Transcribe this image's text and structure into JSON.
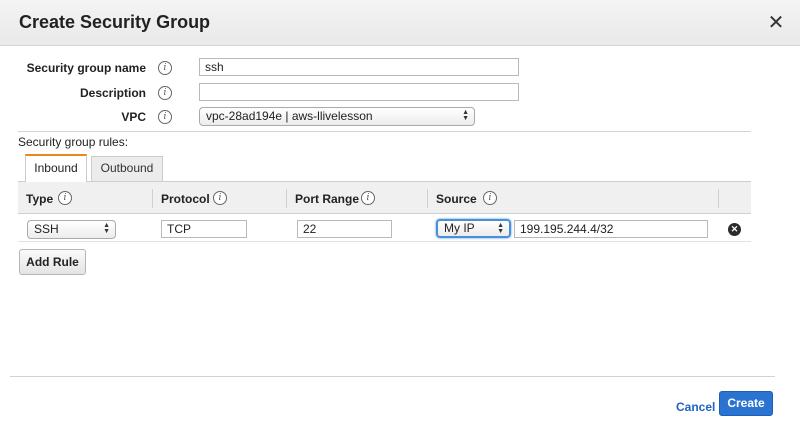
{
  "dialog": {
    "title": "Create Security Group",
    "close_glyph": "✕"
  },
  "form": {
    "name_label": "Security group name",
    "name_value": "ssh",
    "description_label": "Description",
    "description_value": "",
    "vpc_label": "VPC",
    "vpc_value": "vpc-28ad194e | aws-llivelesson",
    "info_glyph": "i"
  },
  "rules": {
    "section_label": "Security group rules:",
    "tabs": [
      {
        "label": "Inbound",
        "active": true
      },
      {
        "label": "Outbound",
        "active": false
      }
    ],
    "columns": [
      "Type",
      "Protocol",
      "Port Range",
      "Source"
    ],
    "rows": [
      {
        "type": "SSH",
        "protocol": "TCP",
        "port_range": "22",
        "source_select": "My IP",
        "source_value": "199.195.244.4/32"
      }
    ],
    "add_rule_label": "Add Rule"
  },
  "footer": {
    "cancel_label": "Cancel",
    "create_label": "Create"
  },
  "colors": {
    "accent_tab": "#e8891a",
    "primary_button": "#2a73d0",
    "link": "#1f63c6"
  },
  "icons": {
    "close": "close-icon",
    "info": "info-icon",
    "remove": "remove-rule-icon",
    "select_arrows": "select-arrows-icon"
  }
}
